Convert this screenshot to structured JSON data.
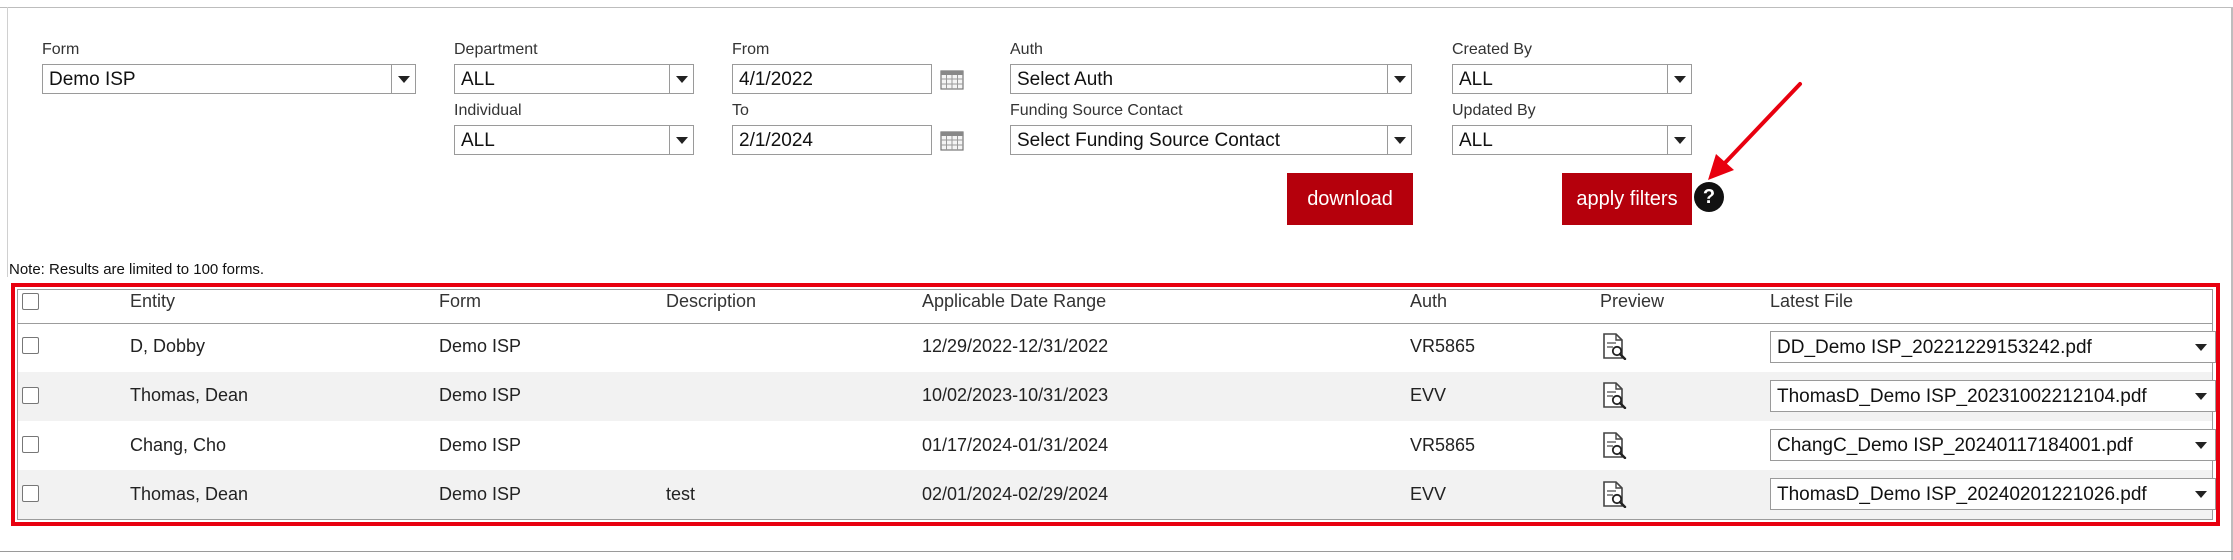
{
  "filters": {
    "form": {
      "label": "Form",
      "value": "Demo ISP"
    },
    "department": {
      "label": "Department",
      "value": "ALL"
    },
    "individual": {
      "label": "Individual",
      "value": "ALL"
    },
    "from": {
      "label": "From",
      "value": "4/1/2022"
    },
    "to": {
      "label": "To",
      "value": "2/1/2024"
    },
    "auth": {
      "label": "Auth",
      "value": "Select Auth"
    },
    "funding_source_contact": {
      "label": "Funding Source Contact",
      "value": "Select Funding Source Contact"
    },
    "created_by": {
      "label": "Created By",
      "value": "ALL"
    },
    "updated_by": {
      "label": "Updated By",
      "value": "ALL"
    }
  },
  "actions": {
    "download": "download",
    "apply_filters": "apply filters",
    "help": "?"
  },
  "note": "Note: Results are limited to 100 forms.",
  "table": {
    "headers": {
      "entity": "Entity",
      "form": "Form",
      "description": "Description",
      "date_range": "Applicable Date Range",
      "auth": "Auth",
      "preview": "Preview",
      "latest_file": "Latest File"
    },
    "rows": [
      {
        "entity": "D, Dobby",
        "form": "Demo ISP",
        "description": "",
        "date_range": "12/29/2022-12/31/2022",
        "auth": "VR5865",
        "latest_file": "DD_Demo ISP_20221229153242.pdf"
      },
      {
        "entity": "Thomas, Dean",
        "form": "Demo ISP",
        "description": "",
        "date_range": "10/02/2023-10/31/2023",
        "auth": "EVV",
        "latest_file": "ThomasD_Demo ISP_20231002212104.pdf"
      },
      {
        "entity": "Chang, Cho",
        "form": "Demo ISP",
        "description": "",
        "date_range": "01/17/2024-01/31/2024",
        "auth": "VR5865",
        "latest_file": "ChangC_Demo ISP_20240117184001.pdf"
      },
      {
        "entity": "Thomas, Dean",
        "form": "Demo ISP",
        "description": "test",
        "date_range": "02/01/2024-02/29/2024",
        "auth": "EVV",
        "latest_file": "ThomasD_Demo ISP_20240201221026.pdf"
      }
    ]
  },
  "colors": {
    "accent_red": "#b5000c",
    "highlight_red": "#e8000f"
  }
}
